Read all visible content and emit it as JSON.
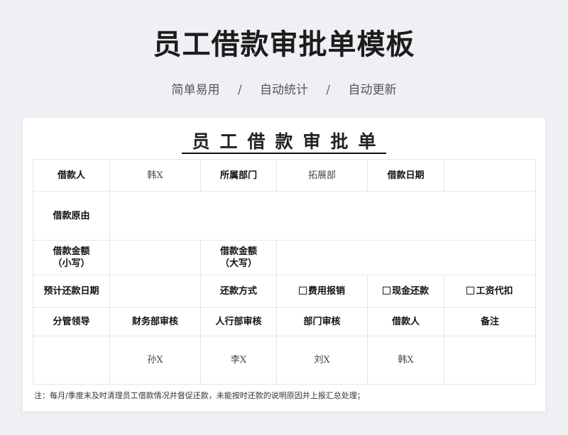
{
  "header": {
    "title": "员工借款审批单模板",
    "features": [
      "简单易用",
      "自动统计",
      "自动更新"
    ],
    "separator": "/"
  },
  "form": {
    "title": "员工借款审批单",
    "row1": {
      "borrower_label": "借款人",
      "borrower_value": "韩X",
      "dept_label": "所属部门",
      "dept_value": "拓展部",
      "date_label": "借款日期",
      "date_value": ""
    },
    "row2": {
      "reason_label": "借款原由",
      "reason_value": ""
    },
    "row3": {
      "amount_small_label": "借款金额",
      "amount_small_sub": "（小写）",
      "amount_big_label": "借款金额",
      "amount_big_sub": "（大写）"
    },
    "row4": {
      "repay_date_label": "预计还款日期",
      "repay_method_label": "还款方式",
      "options": [
        "费用报销",
        "现金还款",
        "工资代扣"
      ]
    },
    "row5": {
      "headers": [
        "分管领导",
        "财务部审核",
        "人行部审核",
        "部门审核",
        "借款人",
        "备注"
      ]
    },
    "row6": {
      "values": [
        "",
        "孙X",
        "李X",
        "刘X",
        "韩X",
        ""
      ]
    },
    "note": "注：每月/季度末及时清理员工借款情况并督促还款，未能按时还款的说明原因并上报汇总处理；"
  }
}
